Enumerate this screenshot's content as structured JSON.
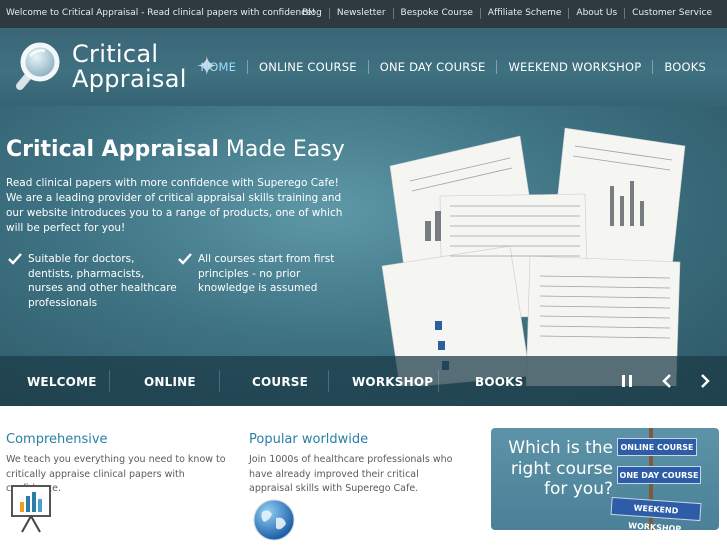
{
  "topbar": {
    "welcome": "Welcome to Critical Appraisal - Read clinical papers with confidence!",
    "links": [
      "Blog",
      "Newsletter",
      "Bespoke Course",
      "Affiliate Scheme",
      "About Us",
      "Customer Service"
    ]
  },
  "header": {
    "logo_line1": "Critical",
    "logo_line2": "Appraisal",
    "nav": [
      "HOME",
      "ONLINE COURSE",
      "ONE DAY COURSE",
      "WEEKEND WORKSHOP",
      "BOOKS"
    ],
    "active_nav": "HOME",
    "active_color": "#9fdcff"
  },
  "hero": {
    "title_bold": "Critical Appraisal",
    "title_light": "Made Easy",
    "description": "Read clinical papers with more confidence with Superego Cafe! We are a leading provider of critical appraisal skills training and our website introduces you to a range of products, one of which will be perfect for you!",
    "features": [
      "Suitable for doctors, dentists, pharmacists, nurses and other healthcare professionals",
      "All courses start from first principles - no prior knowledge is assumed"
    ]
  },
  "slider": {
    "tabs": [
      "WELCOME",
      "ONLINE",
      "COURSE",
      "WORKSHOP",
      "BOOKS"
    ],
    "controls": [
      "pause-icon",
      "chevron-left-icon",
      "chevron-right-icon"
    ]
  },
  "content": {
    "col1": {
      "title": "Comprehensive",
      "text": "We teach you everything you need to know to critically appraise clinical papers with confidence."
    },
    "col2": {
      "title": "Popular worldwide",
      "text": "Join 1000s of healthcare professionals who have already improved their critical appraisal skills with Superego Cafe."
    },
    "promo": {
      "question": "Which is the right course for you?",
      "signs": [
        "ONLINE COURSE",
        "ONE DAY COURSE",
        "WEEKEND WORKSHOP"
      ]
    }
  },
  "colors": {
    "topbar": "#2f3a40",
    "header": "#3f7181",
    "heading_blue": "#2a7fa8",
    "sign_blue": "#2e5da8"
  }
}
